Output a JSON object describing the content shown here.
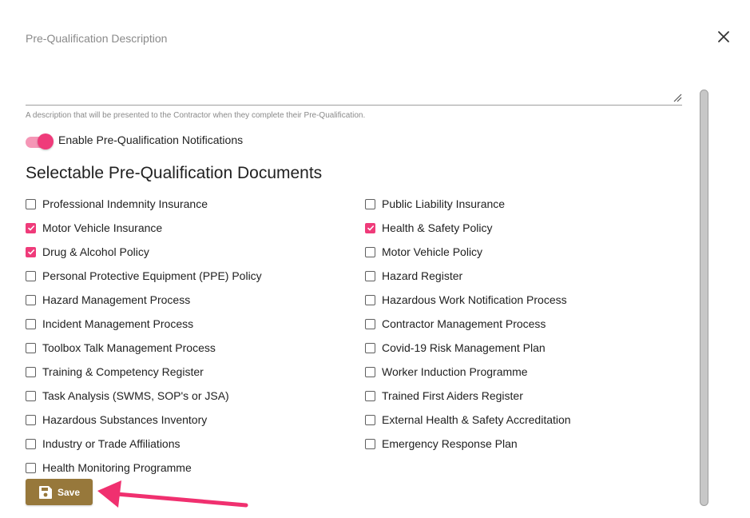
{
  "dialog": {
    "description_label": "Pre-Qualification Description",
    "description_value": "",
    "description_hint": "A description that will be presented to the Contractor when they complete their Pre-Qualification.",
    "close_icon": "close-icon"
  },
  "notifications_toggle": {
    "label": "Enable Pre-Qualification Notifications",
    "enabled": true
  },
  "documents": {
    "title": "Selectable Pre-Qualification Documents",
    "left": [
      {
        "label": "Professional Indemnity Insurance",
        "checked": false
      },
      {
        "label": "Motor Vehicle Insurance",
        "checked": true
      },
      {
        "label": "Drug & Alcohol Policy",
        "checked": true
      },
      {
        "label": "Personal Protective Equipment (PPE) Policy",
        "checked": false
      },
      {
        "label": "Hazard Management Process",
        "checked": false
      },
      {
        "label": "Incident Management Process",
        "checked": false
      },
      {
        "label": "Toolbox Talk Management Process",
        "checked": false
      },
      {
        "label": "Training & Competency Register",
        "checked": false
      },
      {
        "label": "Task Analysis (SWMS, SOP's or JSA)",
        "checked": false
      },
      {
        "label": "Hazardous Substances Inventory",
        "checked": false
      },
      {
        "label": "Industry or Trade Affiliations",
        "checked": false
      },
      {
        "label": "Health Monitoring Programme",
        "checked": false
      }
    ],
    "right": [
      {
        "label": "Public Liability Insurance",
        "checked": false
      },
      {
        "label": "Health & Safety Policy",
        "checked": true
      },
      {
        "label": "Motor Vehicle Policy",
        "checked": false
      },
      {
        "label": "Hazard Register",
        "checked": false
      },
      {
        "label": "Hazardous Work Notification Process",
        "checked": false
      },
      {
        "label": "Contractor Management Process",
        "checked": false
      },
      {
        "label": "Covid-19 Risk Management Plan",
        "checked": false
      },
      {
        "label": "Worker Induction Programme",
        "checked": false
      },
      {
        "label": "Trained First Aiders Register",
        "checked": false
      },
      {
        "label": "External Health & Safety Accreditation",
        "checked": false
      },
      {
        "label": "Emergency Response Plan",
        "checked": false
      }
    ]
  },
  "save_button": {
    "label": "Save",
    "icon": "floppy-disk-icon"
  },
  "colors": {
    "accent": "#ef3b7a",
    "save_button": "#97783b",
    "annotation_arrow": "#f0306f"
  }
}
